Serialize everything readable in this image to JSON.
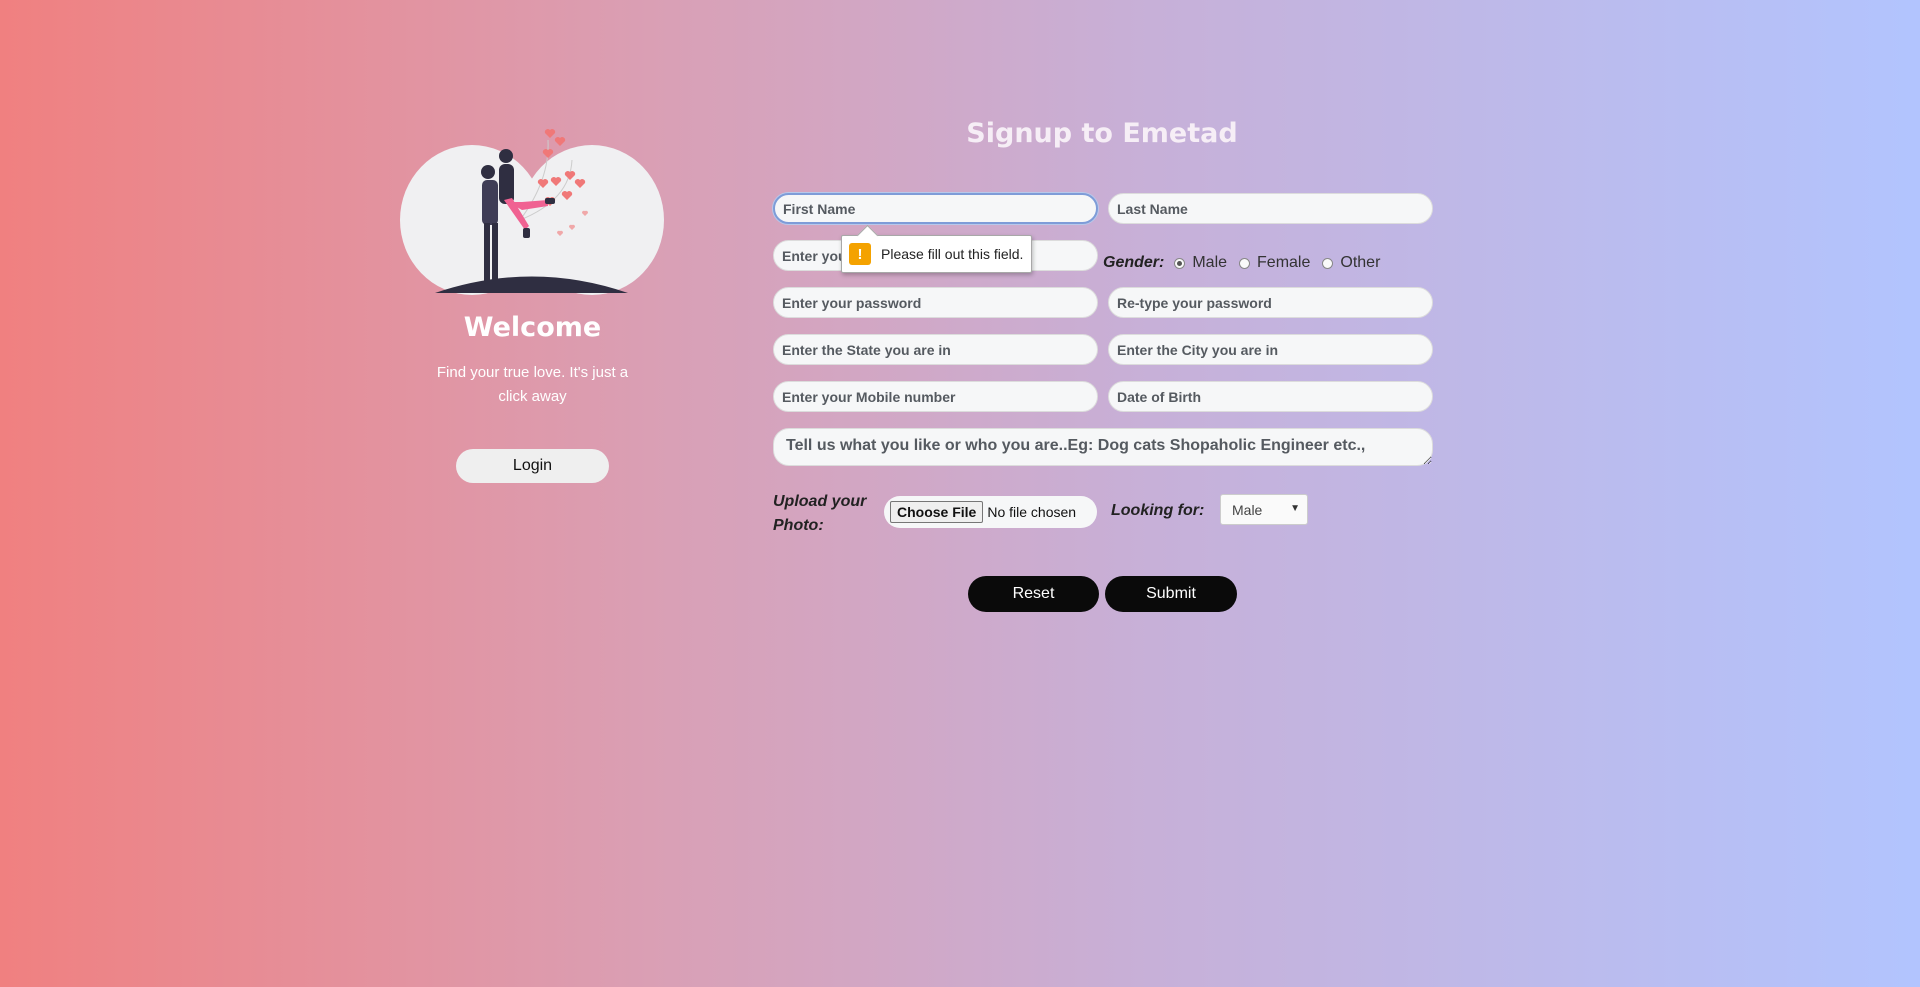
{
  "welcome": {
    "title": "Welcome",
    "subtitle": "Find your true love. It's just a click away",
    "login_label": "Login"
  },
  "form": {
    "title": "Signup to Emetad",
    "first_name_placeholder": "First Name",
    "last_name_placeholder": "Last Name",
    "email_placeholder": "Enter your email",
    "password_placeholder": "Enter your password",
    "retype_password_placeholder": "Re-type your password",
    "state_placeholder": "Enter the State you are in",
    "city_placeholder": "Enter the City you are in",
    "mobile_placeholder": "Enter your Mobile number",
    "dob_placeholder": "Date of Birth",
    "about_placeholder": "Tell us what you like or who you are..Eg: Dog cats Shopaholic Engineer etc.,",
    "gender_label": "Gender:",
    "gender_options": [
      {
        "label": "Male",
        "checked": true
      },
      {
        "label": "Female",
        "checked": false
      },
      {
        "label": "Other",
        "checked": false
      }
    ],
    "upload_label": "Upload your Photo:",
    "choose_file_label": "Choose File",
    "no_file_label": "No file chosen",
    "looking_for_label": "Looking for:",
    "looking_for_value": "Male",
    "reset_label": "Reset",
    "submit_label": "Submit"
  },
  "validation": {
    "icon": "warning-icon",
    "message": "Please fill out this field."
  },
  "colors": {
    "gradient_left": "#f08080",
    "gradient_right": "#b2c4fe",
    "button_dark": "#0a0a0a",
    "warning": "#f4a200",
    "focus_ring": "#7e9cd8"
  }
}
